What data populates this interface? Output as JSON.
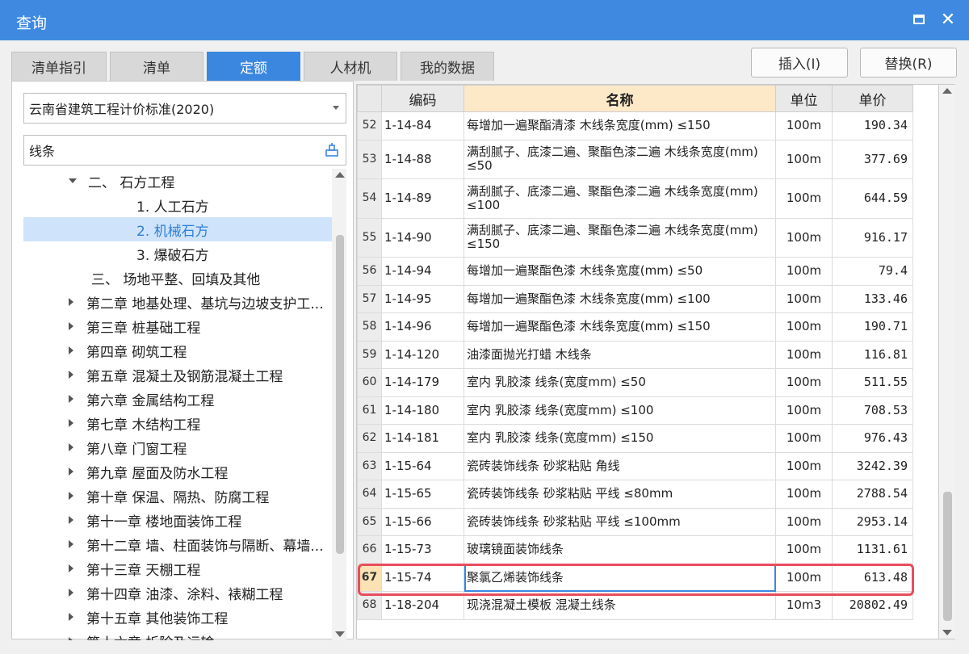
{
  "window": {
    "title": "查询"
  },
  "tabs": [
    {
      "label": "清单指引",
      "active": false
    },
    {
      "label": "清单",
      "active": false
    },
    {
      "label": "定额",
      "active": true
    },
    {
      "label": "人材机",
      "active": false
    },
    {
      "label": "我的数据",
      "active": false
    }
  ],
  "buttons": {
    "insert": "插入(I)",
    "replace": "替换(R)"
  },
  "standard_select": {
    "value": "云南省建筑工程计价标准(2020)"
  },
  "search": {
    "value": "线条"
  },
  "tree": [
    {
      "label": "二、 石方工程",
      "level": 1,
      "expanded": true,
      "selected": false
    },
    {
      "label": "1. 人工石方",
      "level": 2,
      "selected": false
    },
    {
      "label": "2. 机械石方",
      "level": 2,
      "selected": true
    },
    {
      "label": "3. 爆破石方",
      "level": 2,
      "selected": false
    },
    {
      "label": "三、 场地平整、回填及其他",
      "level": 1,
      "selected": false
    },
    {
      "label": "第二章 地基处理、基坑与边坡支护工...",
      "level": 0,
      "selected": false
    },
    {
      "label": "第三章 桩基础工程",
      "level": 0,
      "selected": false
    },
    {
      "label": "第四章 砌筑工程",
      "level": 0,
      "selected": false
    },
    {
      "label": "第五章 混凝土及钢筋混凝土工程",
      "level": 0,
      "selected": false
    },
    {
      "label": "第六章 金属结构工程",
      "level": 0,
      "selected": false
    },
    {
      "label": "第七章 木结构工程",
      "level": 0,
      "selected": false
    },
    {
      "label": "第八章 门窗工程",
      "level": 0,
      "selected": false
    },
    {
      "label": "第九章 屋面及防水工程",
      "level": 0,
      "selected": false
    },
    {
      "label": "第十章 保温、隔热、防腐工程",
      "level": 0,
      "selected": false
    },
    {
      "label": "第十一章 楼地面装饰工程",
      "level": 0,
      "selected": false
    },
    {
      "label": "第十二章 墙、柱面装饰与隔断、幕墙...",
      "level": 0,
      "selected": false
    },
    {
      "label": "第十三章 天棚工程",
      "level": 0,
      "selected": false
    },
    {
      "label": "第十四章 油漆、涂料、裱糊工程",
      "level": 0,
      "selected": false
    },
    {
      "label": "第十五章 其他装饰工程",
      "level": 0,
      "selected": false
    },
    {
      "label": "第十六章 拆除及运输",
      "level": 0,
      "selected": false
    }
  ],
  "table": {
    "headers": {
      "code": "编码",
      "name": "名称",
      "unit": "单位",
      "price": "单价"
    },
    "rows": [
      {
        "n": "52",
        "code": "1-14-84",
        "name": "每增加一遍聚酯清漆 木线条宽度(mm) ≤150",
        "unit": "100m",
        "price": "190.34"
      },
      {
        "n": "53",
        "code": "1-14-88",
        "name": "满刮腻子、底漆二遍、聚酯色漆二遍 木线条宽度(mm) ≤50",
        "unit": "100m",
        "price": "377.69"
      },
      {
        "n": "54",
        "code": "1-14-89",
        "name": "满刮腻子、底漆二遍、聚酯色漆二遍 木线条宽度(mm) ≤100",
        "unit": "100m",
        "price": "644.59"
      },
      {
        "n": "55",
        "code": "1-14-90",
        "name": "满刮腻子、底漆二遍、聚酯色漆二遍 木线条宽度(mm) ≤150",
        "unit": "100m",
        "price": "916.17"
      },
      {
        "n": "56",
        "code": "1-14-94",
        "name": "每增加一遍聚酯色漆 木线条宽度(mm) ≤50",
        "unit": "100m",
        "price": "79.4"
      },
      {
        "n": "57",
        "code": "1-14-95",
        "name": "每增加一遍聚酯色漆 木线条宽度(mm) ≤100",
        "unit": "100m",
        "price": "133.46"
      },
      {
        "n": "58",
        "code": "1-14-96",
        "name": "每增加一遍聚酯色漆 木线条宽度(mm) ≤150",
        "unit": "100m",
        "price": "190.71"
      },
      {
        "n": "59",
        "code": "1-14-120",
        "name": "油漆面抛光打蜡 木线条",
        "unit": "100m",
        "price": "116.81"
      },
      {
        "n": "60",
        "code": "1-14-179",
        "name": "室内 乳胶漆 线条(宽度mm) ≤50",
        "unit": "100m",
        "price": "511.55"
      },
      {
        "n": "61",
        "code": "1-14-180",
        "name": "室内 乳胶漆 线条(宽度mm) ≤100",
        "unit": "100m",
        "price": "708.53"
      },
      {
        "n": "62",
        "code": "1-14-181",
        "name": "室内 乳胶漆 线条(宽度mm) ≤150",
        "unit": "100m",
        "price": "976.43"
      },
      {
        "n": "63",
        "code": "1-15-64",
        "name": "瓷砖装饰线条 砂浆粘贴 角线",
        "unit": "100m",
        "price": "3242.39"
      },
      {
        "n": "64",
        "code": "1-15-65",
        "name": "瓷砖装饰线条 砂浆粘贴 平线 ≤80mm",
        "unit": "100m",
        "price": "2788.54"
      },
      {
        "n": "65",
        "code": "1-15-66",
        "name": "瓷砖装饰线条 砂浆粘贴 平线 ≤100mm",
        "unit": "100m",
        "price": "2953.14"
      },
      {
        "n": "66",
        "code": "1-15-73",
        "name": "玻璃镜面装饰线条",
        "unit": "100m",
        "price": "1131.61"
      },
      {
        "n": "67",
        "code": "1-15-74",
        "name": "聚氯乙烯装饰线条",
        "unit": "100m",
        "price": "613.48"
      },
      {
        "n": "68",
        "code": "1-18-204",
        "name": "现浇混凝土模板 混凝土线条",
        "unit": "10m3",
        "price": "20802.49"
      }
    ]
  }
}
